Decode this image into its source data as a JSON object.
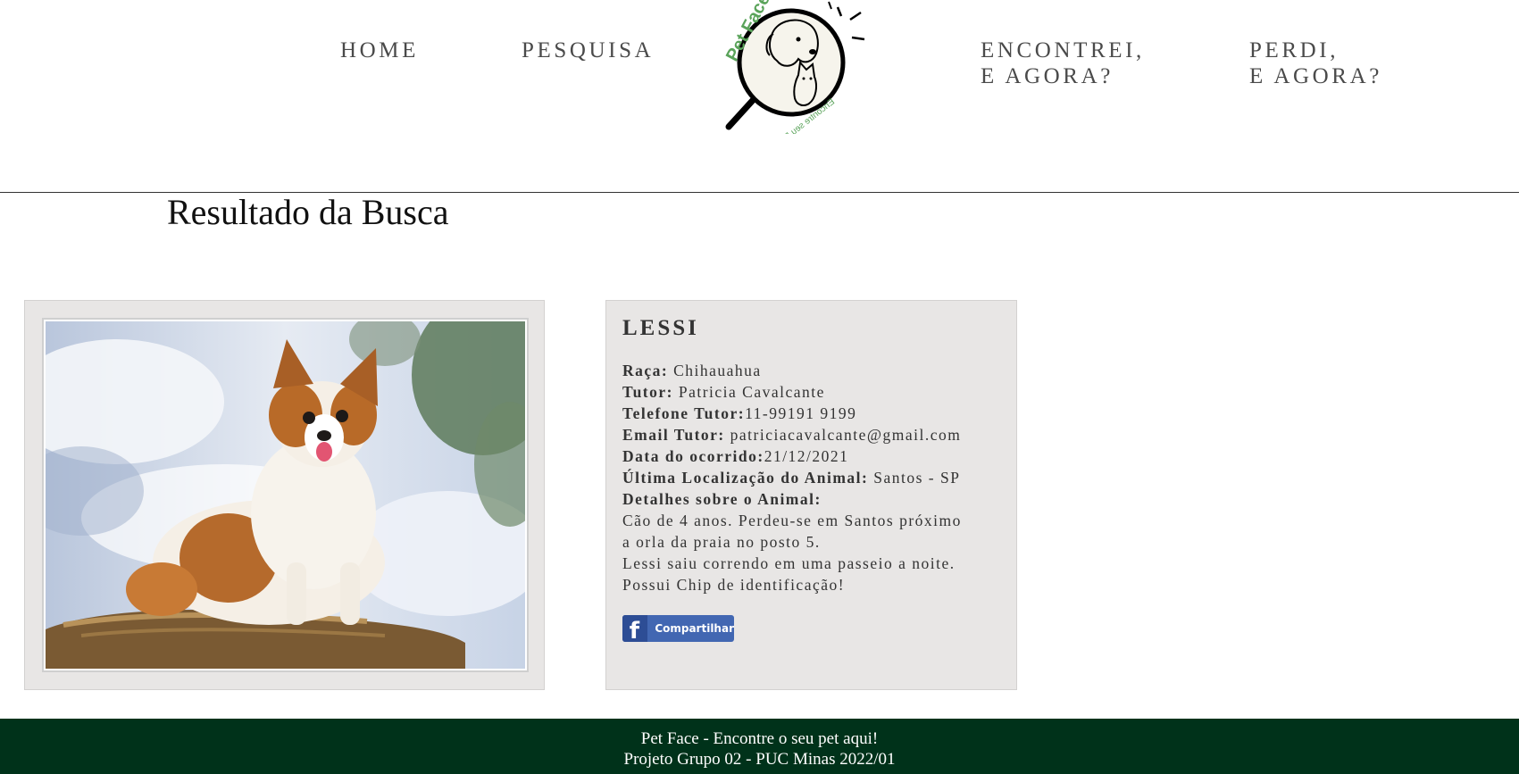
{
  "nav": {
    "home": "HOME",
    "pesquisa": "PESQUISA",
    "encontrei": "ENCONTREI,\nE AGORA?",
    "perdi": "PERDI,\nE AGORA?"
  },
  "logo": {
    "title": "Pet Face",
    "tagline": "Encontre seu Pet"
  },
  "page_title": "Resultado da Busca",
  "pet": {
    "name": "LESSI",
    "raca_label": "Raça:",
    "raca": "Chihauahua",
    "tutor_label": "Tutor:",
    "tutor": "Patricia Cavalcante",
    "telefone_label": "Telefone Tutor:",
    "telefone": "11-99191 9199",
    "email_label": "Email Tutor:",
    "email": "patriciacavalcante@gmail.com",
    "data_label": "Data do ocorrido:",
    "data": "21/12/2021",
    "localizacao_label": "Última Localização do Animal:",
    "localizacao": "Santos - SP",
    "detalhes_label": "Detalhes sobre o Animal:",
    "detalhes": "Cão de 4 anos. Perdeu-se em Santos próximo\na orla da praia no posto 5.\nLessi saiu correndo em uma passeio a noite.\nPossui Chip de identificação!"
  },
  "share": {
    "icon": "facebook-icon",
    "label": "Compartilhar"
  },
  "footer": {
    "line1": "Pet Face - Encontre o seu pet aqui!",
    "line2": "Projeto Grupo 02 - PUC Minas 2022/01"
  },
  "colors": {
    "footer_bg": "#00321a",
    "card_bg": "#e8e6e5",
    "logo_green": "#5aa35a",
    "facebook_blue": "#4267b2"
  }
}
